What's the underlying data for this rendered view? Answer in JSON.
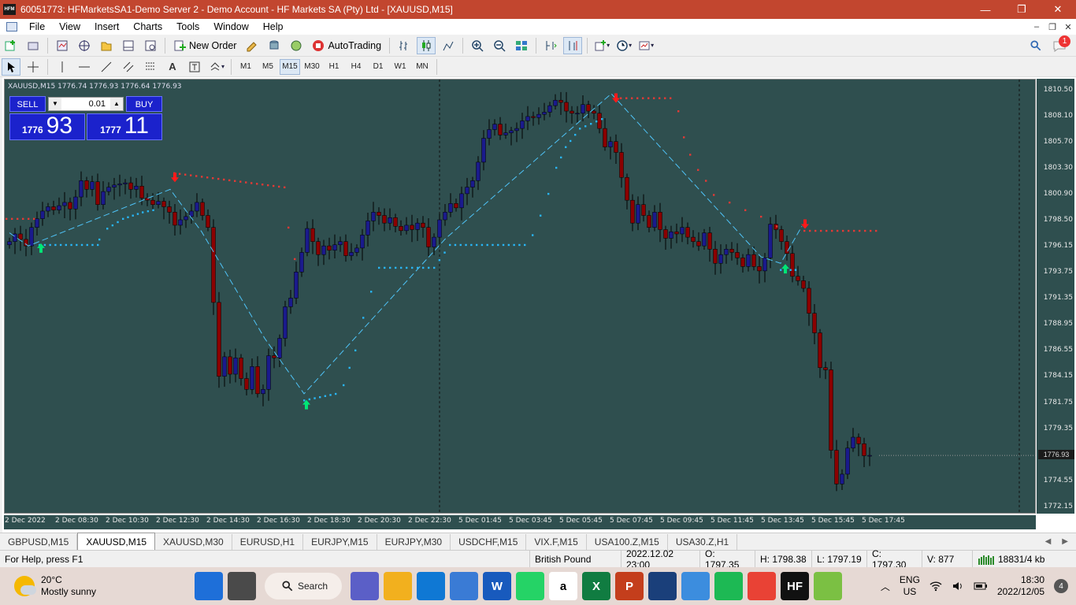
{
  "window": {
    "title": "60051773: HFMarketsSA1-Demo Server 2 - Demo Account - HF Markets SA (Pty) Ltd - [XAUUSD,M15]",
    "app_icon": "HFM",
    "minimize": "—",
    "maximize": "❐",
    "close": "✕"
  },
  "menu": {
    "items": [
      "File",
      "View",
      "Insert",
      "Charts",
      "Tools",
      "Window",
      "Help"
    ]
  },
  "toolbar": {
    "new_order": "New Order",
    "auto_trading": "AutoTrading",
    "notifications": "1"
  },
  "timeframes": [
    "M1",
    "M5",
    "M15",
    "M30",
    "H1",
    "H4",
    "D1",
    "W1",
    "MN"
  ],
  "active_timeframe": "M15",
  "chart": {
    "label": "XAUUSD,M15  1776.74 1776.93 1776.64 1776.93",
    "current_price": "1776.93",
    "one_click": {
      "sell": "SELL",
      "buy": "BUY",
      "lot": "0.01",
      "sell_small": "1776",
      "sell_big": "93",
      "buy_small": "1777",
      "buy_big": "11"
    },
    "y_ticks": [
      "1810.50",
      "1808.10",
      "1805.70",
      "1803.30",
      "1800.90",
      "1798.50",
      "1796.15",
      "1793.75",
      "1791.35",
      "1788.95",
      "1786.55",
      "1784.15",
      "1781.75",
      "1779.35",
      "1776.93",
      "1774.55",
      "1772.15"
    ],
    "x_ticks": [
      "2 Dec 2022",
      "2 Dec 08:30",
      "2 Dec 10:30",
      "2 Dec 12:30",
      "2 Dec 14:30",
      "2 Dec 16:30",
      "2 Dec 18:30",
      "2 Dec 20:30",
      "2 Dec 22:30",
      "5 Dec 01:45",
      "5 Dec 03:45",
      "5 Dec 05:45",
      "5 Dec 07:45",
      "5 Dec 09:45",
      "5 Dec 11:45",
      "5 Dec 13:45",
      "5 Dec 15:45",
      "5 Dec 17:45"
    ],
    "colors": {
      "background": "#2f4f4f",
      "bull": "#1a1a8c",
      "bear": "#8b0000",
      "wick": "#000000",
      "dots_up": "#29b6f6",
      "dots_down": "#e53935",
      "zigzag": "#4fc3f7",
      "arrow_up": "#00e676",
      "arrow_down": "#ff1a1a"
    }
  },
  "chart_data": {
    "type": "candlestick",
    "symbol": "XAUUSD",
    "timeframe": "M15",
    "ylim": [
      1771.5,
      1811.5
    ],
    "ohlc_last": {
      "open": 1776.74,
      "high": 1776.93,
      "low": 1776.64,
      "close": 1776.93
    },
    "closes": [
      1796.6,
      1797.3,
      1796.8,
      1796.2,
      1797.9,
      1798.7,
      1799.4,
      1799.8,
      1799.5,
      1799.9,
      1800.2,
      1799.6,
      1800.7,
      1802.2,
      1801.4,
      1802.1,
      1800.0,
      1801.2,
      1801.6,
      1801.8,
      1801.9,
      1802.0,
      1801.4,
      1801.7,
      1800.6,
      1800.4,
      1800.0,
      1800.3,
      1799.8,
      1799.3,
      1798.1,
      1798.6,
      1798.9,
      1799.4,
      1800.2,
      1799.0,
      1797.9,
      1791.0,
      1784.2,
      1786.0,
      1784.4,
      1785.9,
      1784.0,
      1783.0,
      1785.1,
      1782.6,
      1783.0,
      1786.1,
      1785.9,
      1787.7,
      1790.6,
      1791.4,
      1793.8,
      1795.6,
      1797.8,
      1796.6,
      1795.4,
      1796.2,
      1795.8,
      1796.3,
      1796.6,
      1795.3,
      1795.6,
      1796.0,
      1797.2,
      1798.5,
      1799.3,
      1799.0,
      1798.3,
      1798.8,
      1798.0,
      1797.6,
      1798.1,
      1797.7,
      1798.3,
      1797.9,
      1796.1,
      1797.0,
      1798.6,
      1799.3,
      1800.1,
      1799.7,
      1801.0,
      1801.6,
      1802.2,
      1803.9,
      1806.1,
      1806.9,
      1807.4,
      1806.4,
      1806.6,
      1806.8,
      1807.0,
      1807.7,
      1808.1,
      1808.0,
      1808.3,
      1808.5,
      1809.1,
      1809.6,
      1809.4,
      1808.6,
      1808.4,
      1808.4,
      1809.2,
      1808.6,
      1808.4,
      1807.0,
      1805.3,
      1805.8,
      1804.8,
      1802.5,
      1800.4,
      1798.3,
      1800.0,
      1799.0,
      1797.9,
      1799.3,
      1797.7,
      1796.9,
      1797.5,
      1797.3,
      1797.9,
      1797.0,
      1796.6,
      1796.2,
      1797.4,
      1795.9,
      1794.6,
      1795.4,
      1795.9,
      1795.6,
      1795.1,
      1794.3,
      1795.4,
      1794.3,
      1793.9,
      1795.1,
      1798.2,
      1797.7,
      1796.6,
      1795.5,
      1793.4,
      1793.0,
      1792.3,
      1790.0,
      1788.2,
      1785.0,
      1784.8,
      1777.4,
      1774.3,
      1775.2,
      1777.6,
      1778.6,
      1778.0,
      1776.9,
      1776.93
    ]
  },
  "tabs": [
    "GBPUSD,M15",
    "XAUUSD,M15",
    "XAUUSD,M30",
    "EURUSD,H1",
    "EURJPY,M15",
    "EURJPY,M30",
    "USDCHF,M15",
    "VIX.F,M15",
    "USA100.Z,M15",
    "USA30.Z,H1"
  ],
  "active_tab": "XAUUSD,M15",
  "status": {
    "help": "For Help, press F1",
    "profile": "British Pound",
    "datetime": "2022.12.02 23:00",
    "open": "O: 1797.35",
    "high": "H: 1798.38",
    "low": "L: 1797.19",
    "close": "C: 1797.30",
    "volume": "V: 877",
    "traffic": "18831/4 kb"
  },
  "taskbar": {
    "weather_temp": "20°C",
    "weather_text": "Mostly sunny",
    "search": "Search",
    "lang1": "ENG",
    "lang2": "US",
    "time": "18:30",
    "date": "2022/12/05",
    "notif_count": "4",
    "apps": [
      {
        "name": "windows-start-icon",
        "color": "#1e6fd9",
        "label": ""
      },
      {
        "name": "task-view-icon",
        "color": "#4a4a4a",
        "label": ""
      },
      {
        "name": "teams-icon",
        "color": "#5b5fc7",
        "label": ""
      },
      {
        "name": "file-explorer-icon",
        "color": "#f2b01e",
        "label": ""
      },
      {
        "name": "mail-icon",
        "color": "#0f78d4",
        "label": ""
      },
      {
        "name": "store-icon",
        "color": "#3a7bd5",
        "label": ""
      },
      {
        "name": "word-icon",
        "color": "#185abd",
        "label": "W"
      },
      {
        "name": "whatsapp-icon",
        "color": "#25d366",
        "label": ""
      },
      {
        "name": "amazon-icon",
        "color": "#ffffff",
        "label": "a"
      },
      {
        "name": "excel-icon",
        "color": "#107c41",
        "label": "X"
      },
      {
        "name": "powerpoint-icon",
        "color": "#c43e1c",
        "label": "P"
      },
      {
        "name": "security-icon",
        "color": "#1a3f7a",
        "label": ""
      },
      {
        "name": "photos-icon",
        "color": "#3c8dde",
        "label": ""
      },
      {
        "name": "spotify-icon",
        "color": "#1db954",
        "label": ""
      },
      {
        "name": "chrome-icon",
        "color": "#e94235",
        "label": ""
      },
      {
        "name": "hfm-icon",
        "color": "#111111",
        "label": "HF"
      },
      {
        "name": "bluestacks-icon",
        "color": "#7bc043",
        "label": ""
      }
    ]
  }
}
